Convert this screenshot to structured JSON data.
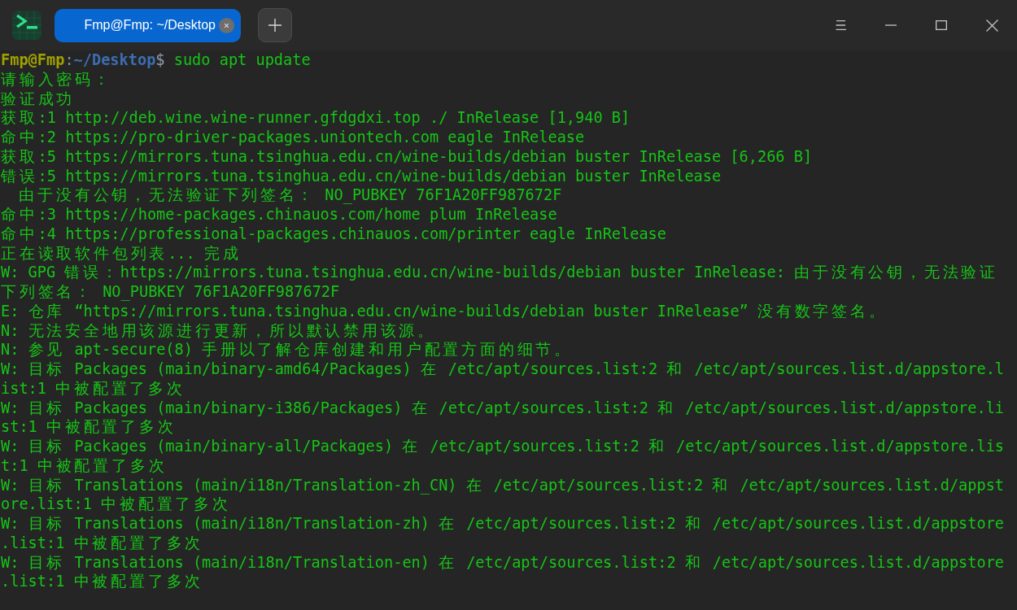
{
  "window": {
    "tabs": [
      {
        "label": "Fmp@Fmp: ~/Desktop",
        "selected": true
      }
    ]
  },
  "terminal": {
    "prompt": {
      "user_host": "Fmp@Fmp",
      "separator": ":",
      "path": "~/Desktop",
      "symbol": "$",
      "command": "sudo apt update"
    },
    "lines": [
      "请输入密码：",
      "验证成功",
      "获取:1 http://deb.wine.wine-runner.gfdgdxi.top ./ InRelease [1,940 B]",
      "命中:2 https://pro-driver-packages.uniontech.com eagle InRelease",
      "获取:5 https://mirrors.tuna.tsinghua.edu.cn/wine-builds/debian buster InRelease [6,266 B]",
      "错误:5 https://mirrors.tuna.tsinghua.edu.cn/wine-builds/debian buster InRelease",
      "  由于没有公钥，无法验证下列签名： NO_PUBKEY 76F1A20FF987672F",
      "命中:3 https://home-packages.chinauos.com/home plum InRelease",
      "命中:4 https://professional-packages.chinauos.com/printer eagle InRelease",
      "正在读取软件包列表... 完成",
      "W: GPG 错误：https://mirrors.tuna.tsinghua.edu.cn/wine-builds/debian buster InRelease: 由于没有公钥，无法验证",
      "下列签名： NO_PUBKEY 76F1A20FF987672F",
      "E: 仓库 “https://mirrors.tuna.tsinghua.edu.cn/wine-builds/debian buster InRelease” 没有数字签名。",
      "N: 无法安全地用该源进行更新，所以默认禁用该源。",
      "N: 参见 apt-secure(8) 手册以了解仓库创建和用户配置方面的细节。",
      "W: 目标 Packages (main/binary-amd64/Packages) 在 /etc/apt/sources.list:2 和 /etc/apt/sources.list.d/appstore.l",
      "ist:1 中被配置了多次",
      "W: 目标 Packages (main/binary-i386/Packages) 在 /etc/apt/sources.list:2 和 /etc/apt/sources.list.d/appstore.li",
      "st:1 中被配置了多次",
      "W: 目标 Packages (main/binary-all/Packages) 在 /etc/apt/sources.list:2 和 /etc/apt/sources.list.d/appstore.lis",
      "t:1 中被配置了多次",
      "W: 目标 Translations (main/i18n/Translation-zh_CN) 在 /etc/apt/sources.list:2 和 /etc/apt/sources.list.d/appst",
      "ore.list:1 中被配置了多次",
      "W: 目标 Translations (main/i18n/Translation-zh) 在 /etc/apt/sources.list:2 和 /etc/apt/sources.list.d/appstore",
      ".list:1 中被配置了多次",
      "W: 目标 Translations (main/i18n/Translation-en) 在 /etc/apt/sources.list:2 和 /etc/apt/sources.list.d/appstore",
      ".list:1 中被配置了多次"
    ]
  }
}
